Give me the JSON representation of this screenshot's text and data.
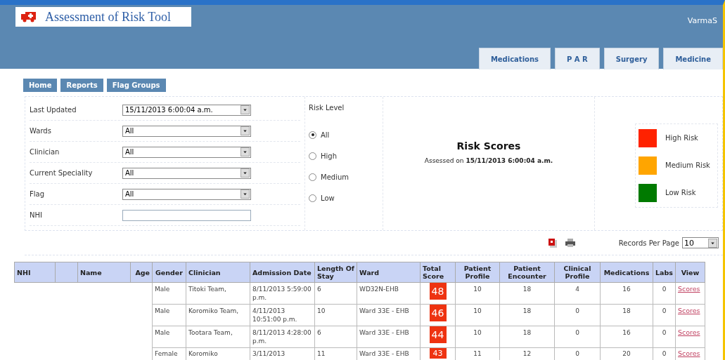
{
  "app": {
    "title": "Assessment of Risk Tool",
    "user": "VarmaS"
  },
  "tabs": [
    {
      "label": "Medications"
    },
    {
      "label": "P A R"
    },
    {
      "label": "Surgery"
    },
    {
      "label": "Medicine"
    }
  ],
  "nav": [
    "Home",
    "Reports",
    "Flag Groups"
  ],
  "filters": [
    {
      "label": "Last Updated",
      "kind": "select",
      "value": "15/11/2013 6:00:04 a.m."
    },
    {
      "label": "Wards",
      "kind": "select",
      "value": "All"
    },
    {
      "label": "Clinician",
      "kind": "select",
      "value": "All"
    },
    {
      "label": "Current Speciality",
      "kind": "select",
      "value": "All"
    },
    {
      "label": "Flag",
      "kind": "select",
      "value": "All"
    },
    {
      "label": "NHI",
      "kind": "text"
    }
  ],
  "risk_level": {
    "title": "Risk Level",
    "options": [
      {
        "label": "All",
        "selected": true
      },
      {
        "label": "High",
        "selected": false
      },
      {
        "label": "Medium",
        "selected": false
      },
      {
        "label": "Low",
        "selected": false
      }
    ]
  },
  "risk_scores": {
    "title": "Risk Scores",
    "assessed": "Assessed on **15/11/2013 6:00:04 a.m.**"
  },
  "legend": [
    {
      "label": "High Risk",
      "color": "#ff2200"
    },
    {
      "label": "Medium Risk",
      "color": "#ffa500"
    },
    {
      "label": "Low Risk",
      "color": "#007a00"
    }
  ],
  "records_per_page": {
    "label": "Records Per Page",
    "value": "10"
  },
  "table": {
    "columns": [
      "NHI",
      "Name",
      "Age",
      "Gender",
      "Clinician",
      "Admission Date",
      "Length Of Stay",
      "Ward",
      "Total Score",
      "Patient Profile",
      "Patient Encounter",
      "Clinical Profile",
      "Medications",
      "Labs",
      "View"
    ],
    "rows": [
      {
        "gender": "Male",
        "clinician": "Titoki Team,",
        "admission_date": "8/11/2013 5:59:00 p.m.",
        "length_of_stay": "6",
        "ward": "WD32N-EHB",
        "total_score": "48",
        "patient_profile": "10",
        "patient_encounter": "18",
        "clinical_profile": "4",
        "medications": "16",
        "labs": "0",
        "view": "Scores"
      },
      {
        "gender": "Male",
        "clinician": "Koromiko Team,",
        "admission_date": "4/11/2013 10:51:00 p.m.",
        "length_of_stay": "10",
        "ward": "Ward 33E - EHB",
        "total_score": "46",
        "patient_profile": "10",
        "patient_encounter": "18",
        "clinical_profile": "0",
        "medications": "18",
        "labs": "0",
        "view": "Scores"
      },
      {
        "gender": "Male",
        "clinician": "Tootara Team,",
        "admission_date": "8/11/2013 4:28:00 p.m.",
        "length_of_stay": "6",
        "ward": "Ward 33E - EHB",
        "total_score": "44",
        "patient_profile": "10",
        "patient_encounter": "18",
        "clinical_profile": "0",
        "medications": "16",
        "labs": "0",
        "view": "Scores"
      },
      {
        "gender": "Female",
        "clinician": "Koromiko",
        "admission_date": "3/11/2013",
        "length_of_stay": "11",
        "ward": "Ward 33E - EHB",
        "total_score": "43",
        "patient_profile": "11",
        "patient_encounter": "12",
        "clinical_profile": "0",
        "medications": "20",
        "labs": "0",
        "view": "Scores"
      }
    ]
  }
}
